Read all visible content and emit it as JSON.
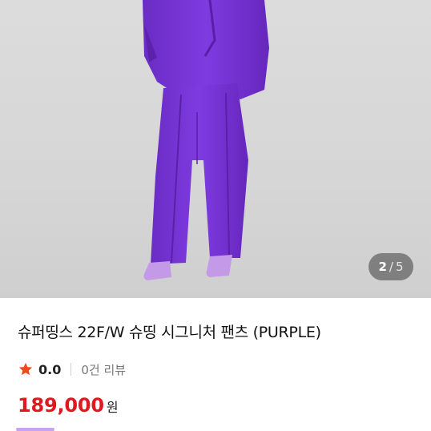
{
  "product": {
    "title": "슈퍼띵스 22F/W 슈띵 시그니처 팬츠 (PURPLE)",
    "rating": "0.0",
    "review_count_text": "0건 리뷰",
    "price": "189,000",
    "currency": "원"
  },
  "gallery": {
    "current": "2",
    "separator": "/",
    "total": "5"
  },
  "colors": {
    "outfit": "#7a35d8",
    "price": "#e0181f",
    "star": "#f24a1e"
  },
  "icons": {
    "rating": "star-icon"
  }
}
